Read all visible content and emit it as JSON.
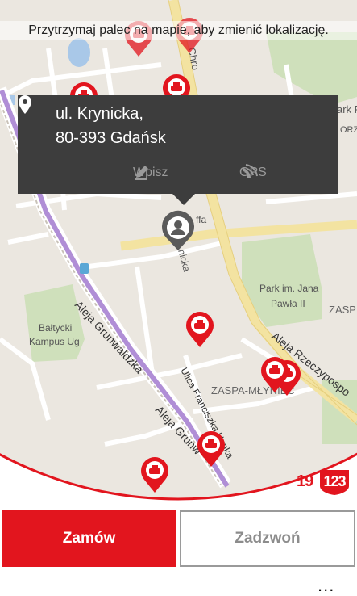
{
  "hint_text": "Przytrzymaj palec na mapie, aby zmienić lokalizację.",
  "location": {
    "line1": "ul. Krynicka,",
    "line2": "80-393 Gdańsk",
    "actions": {
      "manual": "Wpisz",
      "gps": "GPS"
    }
  },
  "map_labels": {
    "street_chro": "Chro",
    "park_k": "ark P",
    "park_orz": "ORZ",
    "krynicka": "nicka",
    "street_ffa": "ffa",
    "park_jana": "Park im. Jana Pawła II",
    "baltycki": "Bałtycki Kampus Ug",
    "grunwaldzka1": "Aleja Grunwaldzka",
    "grunwaldzka2": "Aleja Grunw",
    "rzeczypospolitej": "Aleja Rzeczypospo",
    "hynka": "Ulica Franciszka Hynka",
    "zaspa_mlyniec": "ZASPA-MŁYNIEC",
    "zasp": "ZASP"
  },
  "brand": {
    "part1": "19",
    "part2": "123"
  },
  "buttons": {
    "order": "Zamów",
    "call": "Zadzwoń"
  },
  "more": "...",
  "colors": {
    "accent": "#e2151e",
    "popup_bg": "#3d3d3d"
  },
  "icons": [
    "location-pin-icon",
    "pencil-icon",
    "gps-icon",
    "taxi-marker-icon",
    "user-location-icon"
  ]
}
